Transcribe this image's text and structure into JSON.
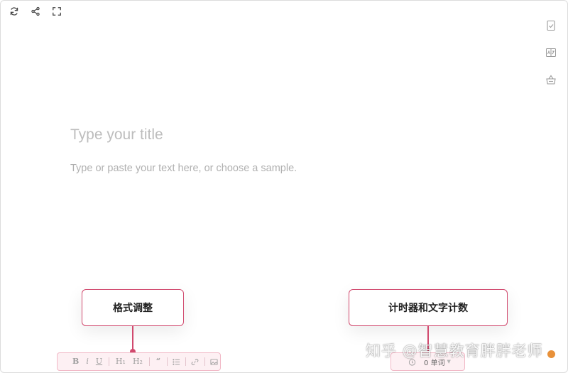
{
  "editor": {
    "title_placeholder": "Type your title",
    "body_placeholder": "Type or paste your text here, or choose a sample."
  },
  "top_tools": [
    "refresh-icon",
    "share-icon",
    "fullscreen-icon"
  ],
  "right_rail": [
    "document-check-icon",
    "translate-icon",
    "basket-icon"
  ],
  "format_toolbar": {
    "bold": "B",
    "italic": "i",
    "underline": "U",
    "h1": "H₁",
    "h2": "H₂",
    "quote": "“",
    "icons": [
      "list-icon",
      "link-icon",
      "image-icon"
    ]
  },
  "stats_toolbar": {
    "word_count": "0 单词",
    "timer_icon": "clock-icon"
  },
  "callouts": {
    "format": "格式调整",
    "stats": "计时器和文字计数"
  },
  "watermark": "知乎 @智慧教育胖胖老师",
  "colors": {
    "accent": "#d1496e",
    "toolbar_bg": "#fdf0f3",
    "toolbar_border": "#f1b8c6",
    "placeholder": "#bdbdbd"
  }
}
